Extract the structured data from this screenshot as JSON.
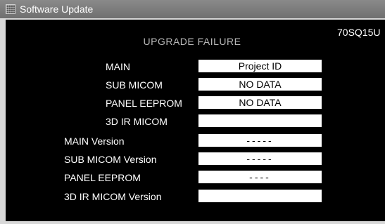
{
  "window": {
    "title": "Software Update"
  },
  "screen": {
    "model": "70SQ15U",
    "heading": "UPGRADE  FAILURE",
    "rows": [
      {
        "label": "MAIN",
        "value": "Project  ID"
      },
      {
        "label": "SUB  MICOM",
        "value": "NO  DATA"
      },
      {
        "label": "PANEL  EEPROM",
        "value": "NO  DATA"
      },
      {
        "label": "3D  IR  MICOM",
        "value": ""
      },
      {
        "label": "MAIN  Version",
        "value": "-----"
      },
      {
        "label": "SUB  MICOM  Version",
        "value": "-----"
      },
      {
        "label": "PANEL  EEPROM",
        "value": "----"
      },
      {
        "label": "3D IR MICOM Version",
        "value": ""
      }
    ]
  }
}
